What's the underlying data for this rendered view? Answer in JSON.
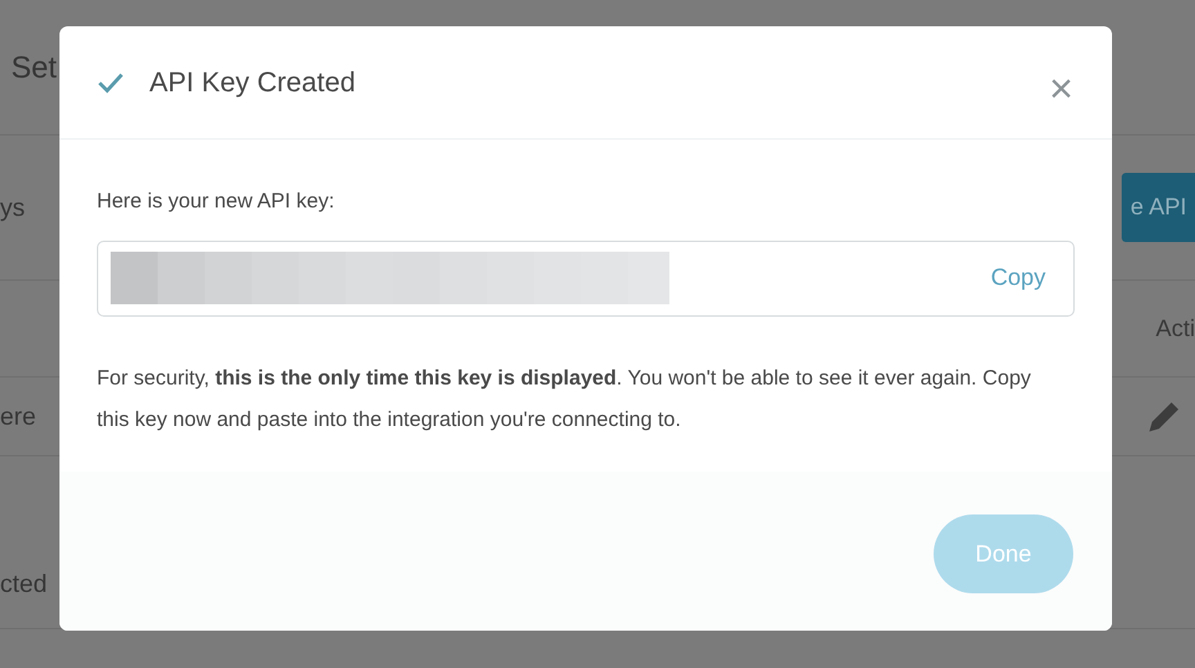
{
  "background_page": {
    "title": "Set",
    "rows": [
      {
        "label": "ys"
      },
      {
        "label": "ere"
      },
      {
        "label": "cted"
      }
    ],
    "create_button": "e API",
    "column_heading": "Acti"
  },
  "dialog": {
    "title": "API Key Created",
    "close_label": "×",
    "key_label": "Here is your new API key:",
    "copy_button": "Copy",
    "notice": "For security, **this is the only time this key is displayed**. You won't be able to see it ever again. Copy this key now and paste into the integration you're connecting to.",
    "done_button": {
      "label": "Done",
      "disabled": true
    }
  }
}
